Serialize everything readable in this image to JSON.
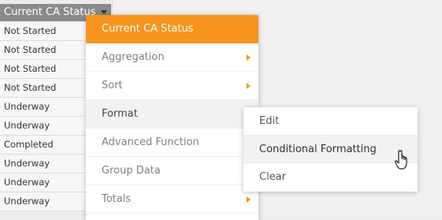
{
  "column": {
    "header_label": "Current CA Status",
    "rows": [
      "Not Started",
      "Not Started",
      "Not Started",
      "Not Started",
      "Underway",
      "Underway",
      "Completed",
      "Underway",
      "Underway",
      "Underway"
    ]
  },
  "menu": {
    "header": "Current CA Status",
    "items": [
      {
        "label": "Aggregation"
      },
      {
        "label": "Sort"
      },
      {
        "label": "Format"
      },
      {
        "label": "Advanced Function"
      },
      {
        "label": "Group Data"
      },
      {
        "label": "Totals"
      }
    ]
  },
  "submenu": {
    "items": [
      {
        "label": "Edit"
      },
      {
        "label": "Conditional Formatting"
      },
      {
        "label": "Clear"
      }
    ]
  },
  "colors": {
    "accent": "#f7941d",
    "header_bg": "#8a8a8a"
  }
}
